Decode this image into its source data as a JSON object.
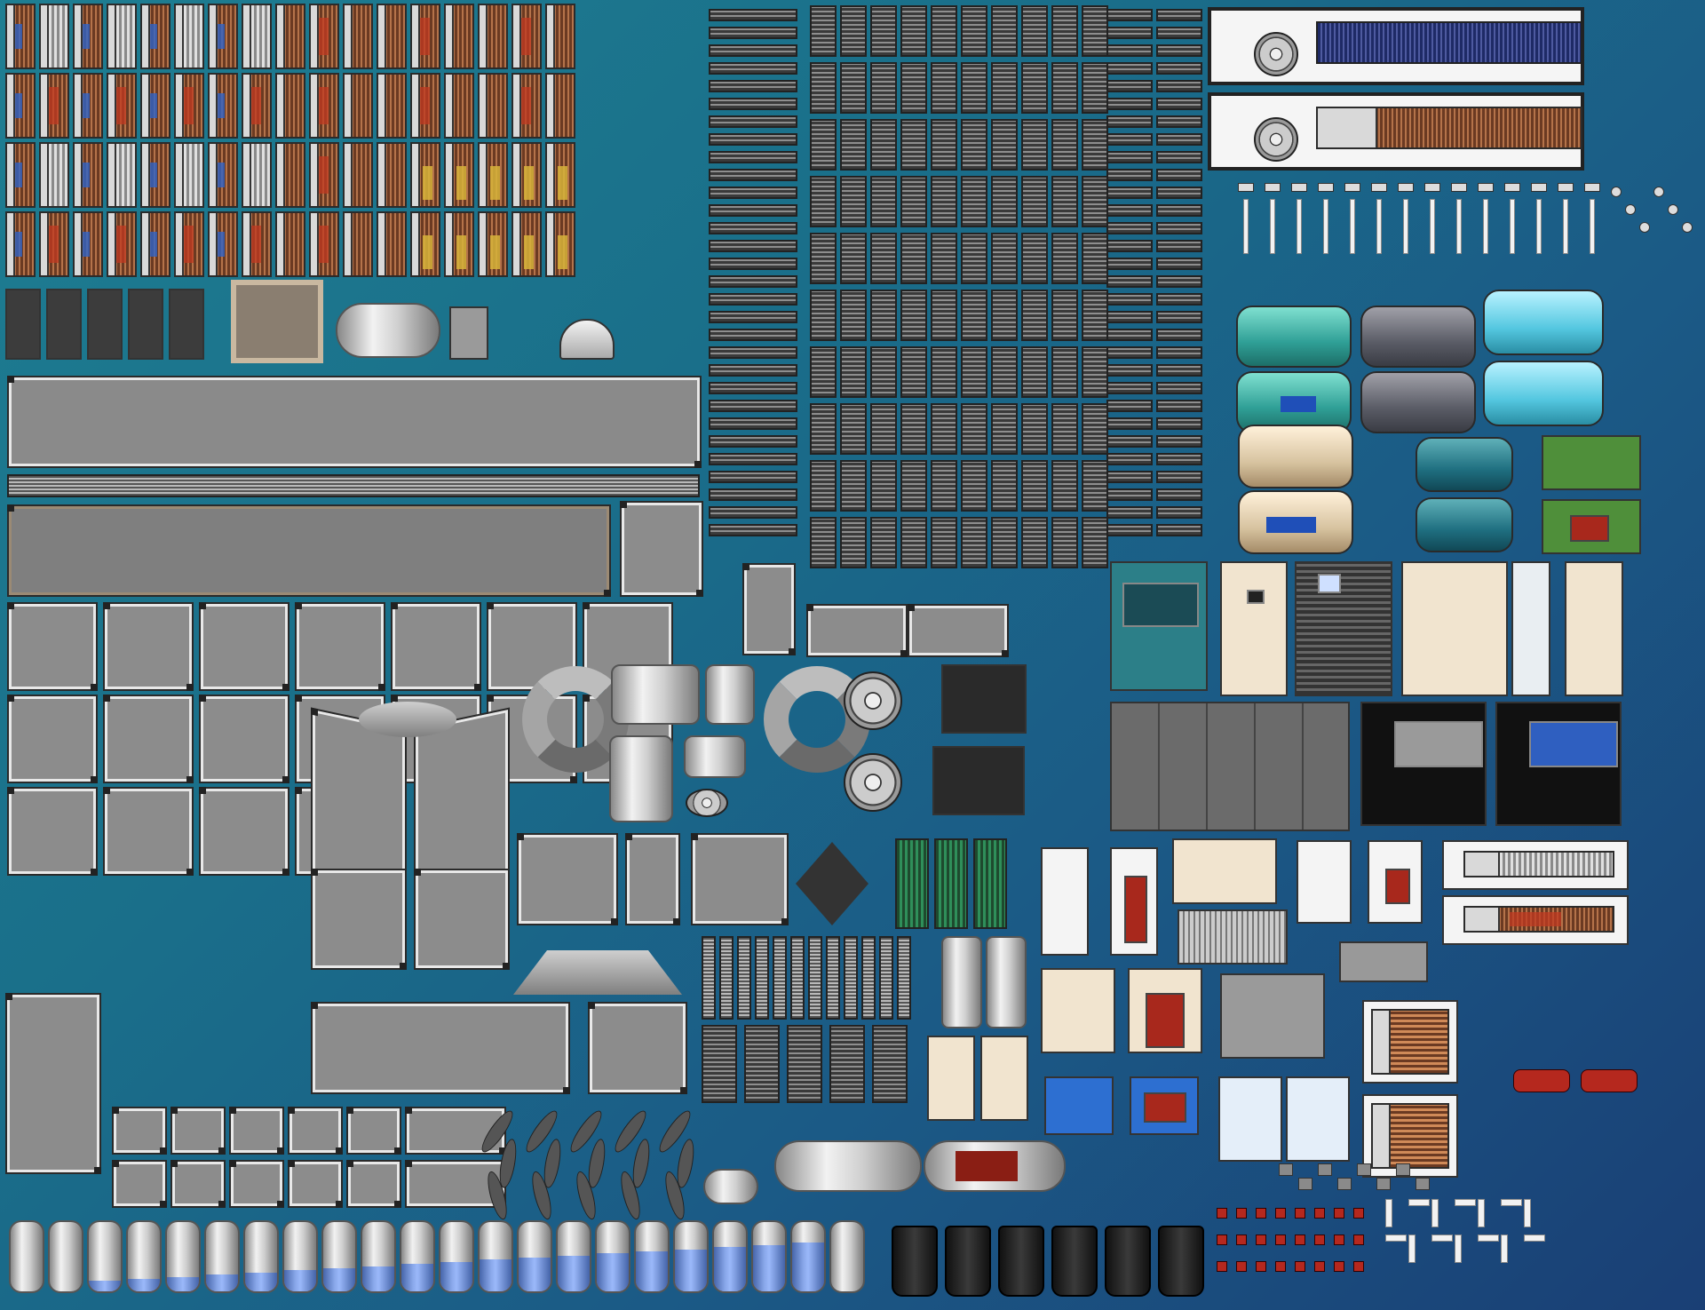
{
  "scene": {
    "description_visible_text": [],
    "palette": {
      "background": "#1b6f8a",
      "duct": "#8c8c8c",
      "duct_edge": "#e8e8e8",
      "copper": "#b5734a",
      "accent_red": "#c23a22",
      "accent_blue": "#2f64c8",
      "accent_yellow": "#d7b43a",
      "chiller_cyan": "#54c7e0",
      "chiller_teal": "#2f9f96",
      "cabinet_cream": "#f1e4cf"
    }
  },
  "groups": {
    "coil_modules": {
      "count": 64,
      "icon": "coil-module-icon"
    },
    "grille_diffusers": {
      "count": 180,
      "icon": "grille-diffuser-icon"
    },
    "rectangular_ducts": {
      "count": 46,
      "icon": "duct-section-icon"
    },
    "round_duct_fittings": {
      "count": 10,
      "icon": "round-duct-elbow-icon"
    },
    "fans_blowers": {
      "count": 6,
      "icon": "centrifugal-fan-icon"
    },
    "chillers": {
      "count": 10,
      "icon": "chiller-unit-icon"
    },
    "cabinets": {
      "count": 18,
      "icon": "equipment-cabinet-icon"
    },
    "storage_tanks": {
      "count": 22,
      "icon": "storage-tank-icon"
    },
    "black_tanks": {
      "count": 6,
      "icon": "black-tank-icon"
    },
    "pipe_fittings": {
      "count": 60,
      "icon": "pipe-fitting-icon"
    }
  }
}
